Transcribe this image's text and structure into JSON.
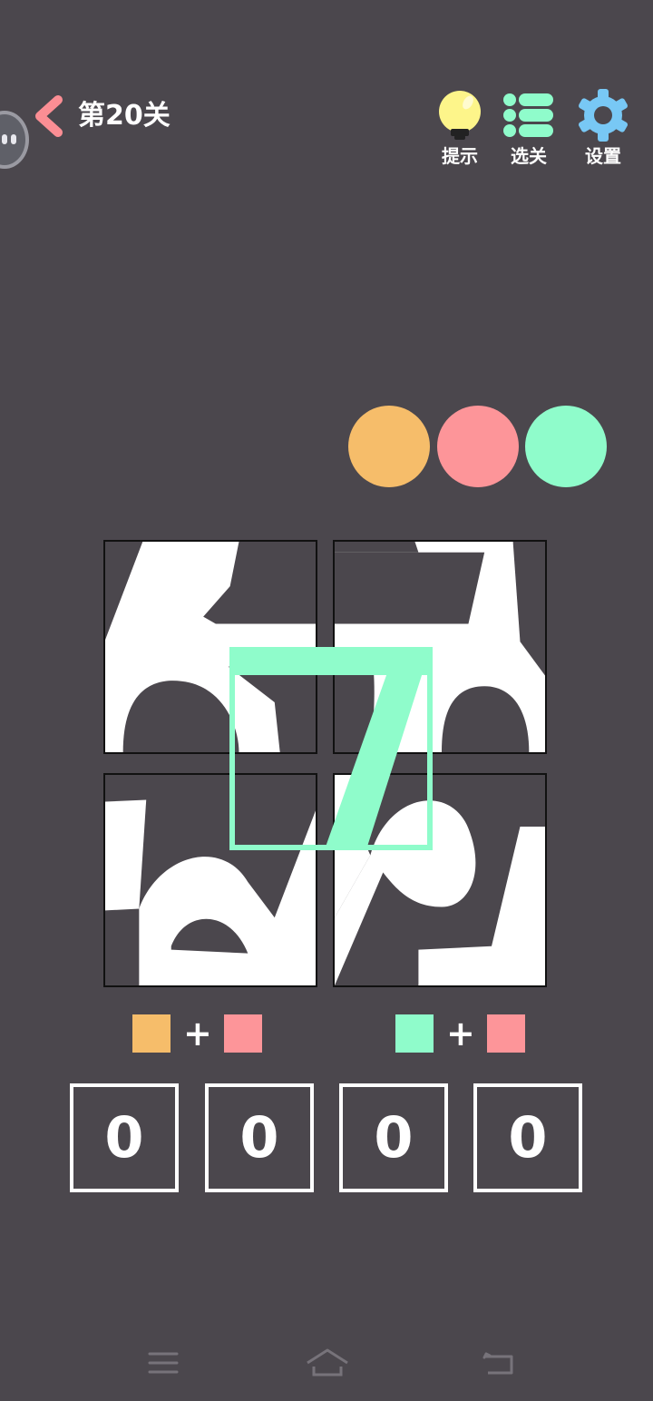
{
  "header": {
    "level_title": "第20关",
    "buttons": [
      {
        "id": "hint",
        "label": "提示",
        "icon": "lightbulb-icon",
        "color": "#fdf58a"
      },
      {
        "id": "levels",
        "label": "选关",
        "icon": "list-icon",
        "color": "#8ffccb"
      },
      {
        "id": "settings",
        "label": "设置",
        "icon": "gear-icon",
        "color": "#78c8f5"
      }
    ]
  },
  "colors": {
    "orange": "#f6bd6a",
    "pink": "#fd9599",
    "green": "#8ffccb",
    "background": "#4b474d",
    "back_arrow": "#fb8e94"
  },
  "color_dots": [
    "#f6bd6a",
    "#fd9599",
    "#8ffccb"
  ],
  "clues": [
    {
      "left": "#f6bd6a",
      "op": "+",
      "right": "#fd9599"
    },
    {
      "left": "#8ffccb",
      "op": "+",
      "right": "#fd9599"
    }
  ],
  "answer_digits": [
    "0",
    "0",
    "0",
    "0"
  ],
  "nav": {
    "icons": [
      "menu-icon",
      "home-icon",
      "back-icon"
    ]
  }
}
